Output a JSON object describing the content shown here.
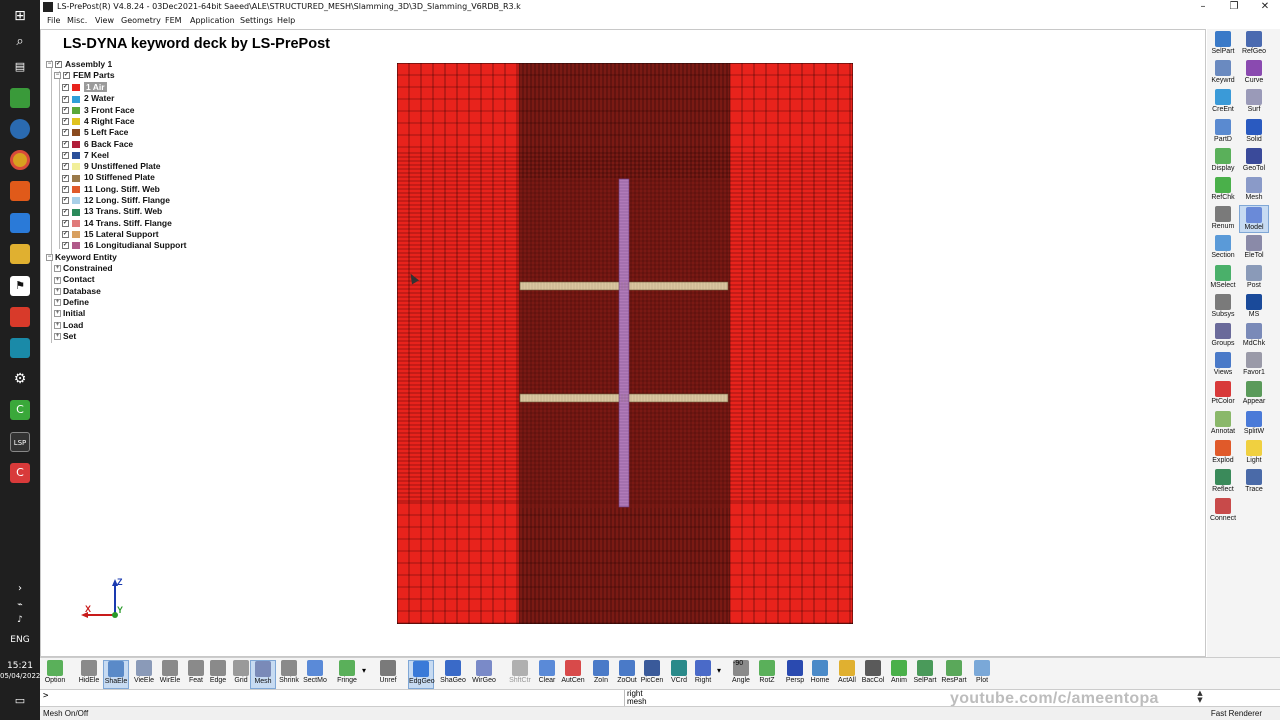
{
  "window": {
    "title": "LS-PrePost(R) V4.8.24 - 03Dec2021-64bit Saeed\\ALE\\STRUCTURED_MESH\\Slamming_3D\\3D_Slamming_V6RDB_R3.k",
    "minimize": "–",
    "maximize": "❐",
    "close": "✕"
  },
  "menu": [
    "File",
    "Misc.",
    "View",
    "Geometry",
    "FEM",
    "Application",
    "Settings",
    "Help"
  ],
  "viewport": {
    "title": "LS-DYNA keyword deck by LS-PrePost"
  },
  "tree": {
    "assembly": "Assembly 1",
    "fem_parts": "FEM Parts",
    "parts": [
      {
        "label": "1 Air",
        "color": "#e8231c",
        "selected": true
      },
      {
        "label": "2 Water",
        "color": "#2f9fd8"
      },
      {
        "label": "3 Front Face",
        "color": "#5aa83a"
      },
      {
        "label": "4 Right Face",
        "color": "#e0c21e"
      },
      {
        "label": "5 Left Face",
        "color": "#8a4a1e"
      },
      {
        "label": "6 Back Face",
        "color": "#b01e3a"
      },
      {
        "label": "7 Keel",
        "color": "#2a4f9a"
      },
      {
        "label": "9 Unstiffened Plate",
        "color": "#f2ef9a"
      },
      {
        "label": "10 Stiffened Plate",
        "color": "#9a7a4a"
      },
      {
        "label": "11 Long. Stiff. Web",
        "color": "#e05a2a"
      },
      {
        "label": "12 Long. Stiff. Flange",
        "color": "#a8d0e8"
      },
      {
        "label": "13 Trans. Stiff. Web",
        "color": "#2a8a5a"
      },
      {
        "label": "14 Trans. Stiff. Flange",
        "color": "#e07a7a"
      },
      {
        "label": "15 Lateral Support",
        "color": "#d8a060"
      },
      {
        "label": "16 Longitudianal Support",
        "color": "#b05a8a"
      }
    ],
    "keyword_entity": "Keyword Entity",
    "keywords": [
      "Constrained",
      "Contact",
      "Database",
      "Define",
      "Initial",
      "Load",
      "Set"
    ]
  },
  "triad": {
    "z": "Z",
    "x": "X",
    "y": "Y"
  },
  "right_panel": [
    {
      "label": "SelPart",
      "icon": "select-part-icon",
      "color": "#3a7ac8"
    },
    {
      "label": "RefGeo",
      "icon": "ref-geometry-icon",
      "color": "#4a6ab0"
    },
    {
      "label": "Keywrd",
      "icon": "keyword-icon",
      "color": "#6a8ac0"
    },
    {
      "label": "Curve",
      "icon": "curve-icon",
      "color": "#8a4ab0"
    },
    {
      "label": "CreEnt",
      "icon": "create-entity-icon",
      "color": "#3a9ad8"
    },
    {
      "label": "Surf",
      "icon": "surface-icon",
      "color": "#9a9ab8"
    },
    {
      "label": "PartD",
      "icon": "part-data-icon",
      "color": "#5a8ad0"
    },
    {
      "label": "Solid",
      "icon": "solid-icon",
      "color": "#2a5ac0"
    },
    {
      "label": "Display",
      "icon": "display-icon",
      "color": "#5ab05a"
    },
    {
      "label": "GeoTol",
      "icon": "geometry-tool-icon",
      "color": "#3a4a9a"
    },
    {
      "label": "RefChk",
      "icon": "reference-check-icon",
      "color": "#4ab04a"
    },
    {
      "label": "Mesh",
      "icon": "mesh-icon",
      "color": "#8a9ac8"
    },
    {
      "label": "Renum",
      "icon": "renumber-icon",
      "color": "#7a7a7a"
    },
    {
      "label": "Model",
      "icon": "model-icon",
      "color": "#6a8ad8"
    },
    {
      "label": "Section",
      "icon": "section-icon",
      "color": "#5a9ad8"
    },
    {
      "label": "EleTol",
      "icon": "element-tool-icon",
      "color": "#8a8aa8"
    },
    {
      "label": "MSelect",
      "icon": "multi-select-icon",
      "color": "#4ab06a"
    },
    {
      "label": "Post",
      "icon": "post-icon",
      "color": "#8a9ab8"
    },
    {
      "label": "Subsys",
      "icon": "subsystem-icon",
      "color": "#7a7a7a"
    },
    {
      "label": "MS",
      "icon": "ms-icon",
      "color": "#1a4a9a"
    },
    {
      "label": "Groups",
      "icon": "groups-icon",
      "color": "#6a6a9a"
    },
    {
      "label": "MdChk",
      "icon": "model-check-icon",
      "color": "#7a8ab8"
    },
    {
      "label": "Views",
      "icon": "views-icon",
      "color": "#4a7ac8"
    },
    {
      "label": "Favor1",
      "icon": "favorite-icon",
      "color": "#9a9aa8"
    },
    {
      "label": "PtColor",
      "icon": "part-color-icon",
      "color": "#d83a3a"
    },
    {
      "label": "Appear",
      "icon": "appearance-icon",
      "color": "#5a9a5a"
    },
    {
      "label": "Annotat",
      "icon": "annotation-icon",
      "color": "#8ab86a"
    },
    {
      "label": "SplitW",
      "icon": "split-window-icon",
      "color": "#4a7ad8"
    },
    {
      "label": "Explod",
      "icon": "explode-icon",
      "color": "#e05a2a"
    },
    {
      "label": "Light",
      "icon": "light-icon",
      "color": "#f0d040"
    },
    {
      "label": "Reflect",
      "icon": "reflect-icon",
      "color": "#3a8a5a"
    },
    {
      "label": "Trace",
      "icon": "trace-icon",
      "color": "#4a6aa8"
    },
    {
      "label": "Connect",
      "icon": "connect-icon",
      "color": "#c84a4a"
    }
  ],
  "bottom_toolbar": [
    {
      "label": "Option",
      "icon": "option-icon",
      "color": "#5ab05a"
    },
    {
      "label": "HidEle",
      "icon": "hidden-element-icon",
      "color": "#8a8a8a"
    },
    {
      "label": "ShaEle",
      "icon": "shaded-element-icon",
      "color": "#5a8ac8",
      "active": true
    },
    {
      "label": "VieEle",
      "icon": "view-element-icon",
      "color": "#8a9ab8"
    },
    {
      "label": "WirEle",
      "icon": "wire-element-icon",
      "color": "#8a8a8a"
    },
    {
      "label": "Feat",
      "icon": "feature-icon",
      "color": "#8a8a8a"
    },
    {
      "label": "Edge",
      "icon": "edge-icon",
      "color": "#8a8a8a"
    },
    {
      "label": "Grid",
      "icon": "grid-icon",
      "color": "#9a9a9a"
    },
    {
      "label": "Mesh",
      "icon": "mesh-icon",
      "color": "#7a8ab8",
      "active": true
    },
    {
      "label": "Shrink",
      "icon": "shrink-icon",
      "color": "#8a8a8a"
    },
    {
      "label": "SectMo",
      "icon": "section-mode-icon",
      "color": "#5a8ad8"
    },
    {
      "label": "Fringe",
      "icon": "fringe-icon",
      "color": "#5ab05a"
    },
    {
      "label": "Unref",
      "icon": "unreferenced-icon",
      "color": "#7a7a7a"
    },
    {
      "label": "EdgGeo",
      "icon": "edge-geometry-icon",
      "color": "#3a7ad8",
      "active": true
    },
    {
      "label": "ShaGeo",
      "icon": "shaded-geometry-icon",
      "color": "#3a6ac8"
    },
    {
      "label": "WirGeo",
      "icon": "wire-geometry-icon",
      "color": "#7a8ac8"
    },
    {
      "label": "ShftCtr",
      "icon": "shift-center-icon",
      "color": "#b0b0b0",
      "dim": true
    },
    {
      "label": "Clear",
      "icon": "clear-icon",
      "color": "#5a8ad8"
    },
    {
      "label": "AutCen",
      "icon": "auto-center-icon",
      "color": "#d84a4a"
    },
    {
      "label": "ZoIn",
      "icon": "zoom-in-icon",
      "color": "#4a7ac8"
    },
    {
      "label": "ZoOut",
      "icon": "zoom-out-icon",
      "color": "#4a7ac8"
    },
    {
      "label": "PicCen",
      "icon": "pick-center-icon",
      "color": "#3a5a9a"
    },
    {
      "label": "VCrd",
      "icon": "view-coordinate-icon",
      "color": "#2a8a8a"
    },
    {
      "label": "Right",
      "icon": "right-view-icon",
      "color": "#4a6ac8"
    },
    {
      "label": "Angle",
      "icon": "angle-icon",
      "color": "#8a8a8a"
    },
    {
      "label": "RotZ",
      "icon": "rotate-z-icon",
      "color": "#5ab05a"
    },
    {
      "label": "Persp",
      "icon": "perspective-icon",
      "color": "#2a4ab0"
    },
    {
      "label": "Home",
      "icon": "home-icon",
      "color": "#4a8ac8"
    },
    {
      "label": "ActAll",
      "icon": "activate-all-icon",
      "color": "#e0b030"
    },
    {
      "label": "BacCol",
      "icon": "background-color-icon",
      "color": "#5a5a5a"
    },
    {
      "label": "Anim",
      "icon": "animation-icon",
      "color": "#4ab04a"
    },
    {
      "label": "SelPart",
      "icon": "select-part-icon",
      "color": "#4a9a5a"
    },
    {
      "label": "ResPart",
      "icon": "restore-part-icon",
      "color": "#5aa85a"
    },
    {
      "label": "Plot",
      "icon": "plot-icon",
      "color": "#7aa8d8"
    }
  ],
  "angle_value": "-90",
  "shift_ctrl": "Shft\nCtrl",
  "cmd": {
    "prompt": ">",
    "history": [
      "right",
      "mesh"
    ]
  },
  "watermark": "youtube.com/c/ameentopa",
  "status": {
    "left": "Mesh On/Off",
    "right": "Fast Renderer"
  },
  "os": {
    "lang": "ENG",
    "time": "15:21",
    "date": "05/04/2022"
  },
  "mesh_colors": {
    "air": "#e8231c",
    "dense_band": "#7a1a14",
    "plate": "#d9c6a0",
    "stiffener": "#b07ab8",
    "grid": "#1a0000"
  }
}
